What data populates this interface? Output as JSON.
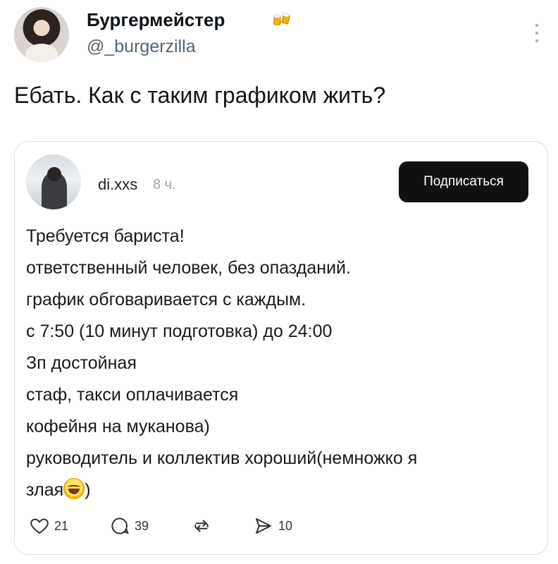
{
  "tweet": {
    "display_name": "Бургермейстер",
    "badge_icon": "beer-mugs-icon",
    "handle": "@_burgerzilla",
    "text": "Ебать. Как с таким графиком жить?",
    "more_icon": "more-vertical-icon"
  },
  "quoted_post": {
    "username": "di.xxs",
    "time": "8 ч.",
    "follow_label": "Подписаться",
    "body_lines": [
      "Требуется бариста!",
      "ответственный человек, без опазданий.",
      "график обговаривается с каждым.",
      "с 7:50 (10 минут подготовка) до 24:00",
      "Зп достойная",
      "стаф, такси оплачивается",
      "кофейня на муканова)",
      "руководитель и коллектив хороший(немножко я",
      "злая"
    ],
    "last_line_suffix": ")",
    "emoji": "grinning-sweat-emoji",
    "actions": {
      "likes": "21",
      "comments": "39",
      "reposts": "",
      "shares": "10"
    }
  },
  "colors": {
    "text": "#0f1419",
    "secondary": "#536471",
    "button_bg": "#111111",
    "card_border": "#dde2e6"
  }
}
